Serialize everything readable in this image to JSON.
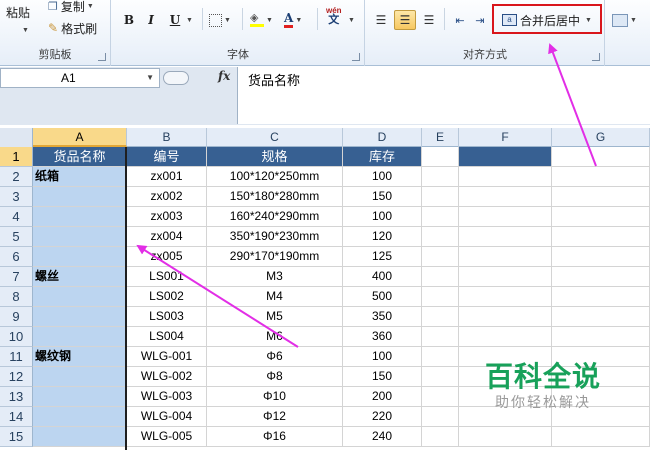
{
  "ribbon": {
    "clipboard": {
      "paste": "粘贴",
      "copy": "复制",
      "format_painter": "格式刷",
      "label": "剪贴板"
    },
    "font": {
      "bold": "B",
      "italic": "I",
      "underline": "U",
      "font_color_letter": "A",
      "wen": "wén",
      "label": "字体"
    },
    "alignment": {
      "merge_center": "合并后居中",
      "label": "对齐方式"
    }
  },
  "formula_bar": {
    "name_box": "A1",
    "fx": "fx",
    "content": "货品名称"
  },
  "columns": [
    "A",
    "B",
    "C",
    "D",
    "E",
    "F",
    "G"
  ],
  "rows": [
    "1",
    "2",
    "3",
    "4",
    "5",
    "6",
    "7",
    "8",
    "9",
    "10",
    "11",
    "12",
    "13",
    "14",
    "15"
  ],
  "table": {
    "headers": [
      "货品名称",
      "编号",
      "规格",
      "库存"
    ],
    "body": [
      [
        "纸箱",
        "zx001",
        "100*120*250mm",
        "100"
      ],
      [
        "",
        "zx002",
        "150*180*280mm",
        "150"
      ],
      [
        "",
        "zx003",
        "160*240*290mm",
        "100"
      ],
      [
        "",
        "zx004",
        "350*190*230mm",
        "120"
      ],
      [
        "",
        "zx005",
        "290*170*190mm",
        "125"
      ],
      [
        "螺丝",
        "LS001",
        "M3",
        "400"
      ],
      [
        "",
        "LS002",
        "M4",
        "500"
      ],
      [
        "",
        "LS003",
        "M5",
        "350"
      ],
      [
        "",
        "LS004",
        "M6",
        "360"
      ],
      [
        "螺纹钢",
        "WLG-001",
        "Φ6",
        "100"
      ],
      [
        "",
        "WLG-002",
        "Φ8",
        "150"
      ],
      [
        "",
        "WLG-003",
        "Φ10",
        "200"
      ],
      [
        "",
        "WLG-004",
        "Φ12",
        "220"
      ],
      [
        "",
        "WLG-005",
        "Φ16",
        "240"
      ]
    ]
  },
  "watermark": {
    "title": "百科全说",
    "subtitle": "助你轻松解决"
  },
  "colors": {
    "header_fill": "#376092",
    "selection_fill": "#bcd5f0",
    "arrow": "#e22ee6",
    "highlight_box": "#d9161c"
  }
}
